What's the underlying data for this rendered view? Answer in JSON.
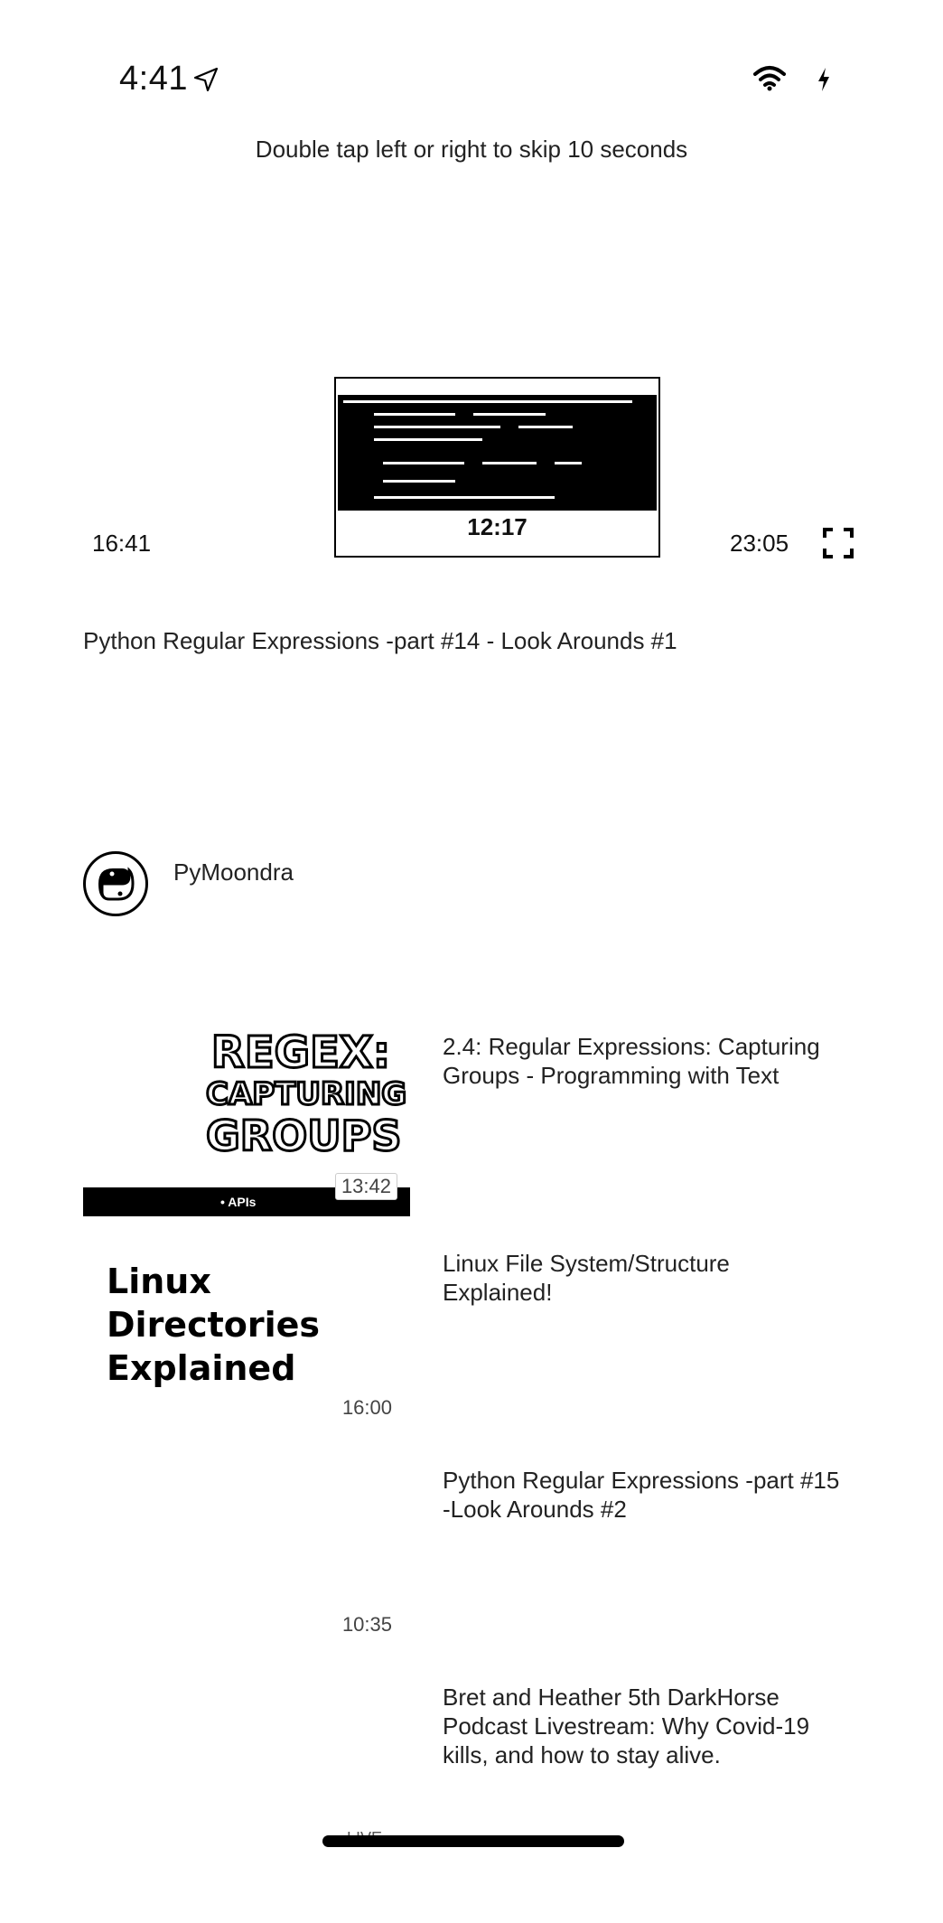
{
  "status_bar": {
    "time": "4:41",
    "icons": [
      "location-arrow-icon",
      "wifi-icon",
      "charging-bolt-icon"
    ]
  },
  "player": {
    "hint": "Double tap left or right to skip 10 seconds",
    "scrub_time": "12:17",
    "elapsed": "16:41",
    "duration": "23:05",
    "fullscreen_icon": "fullscreen-icon"
  },
  "video": {
    "title": "Python Regular Expressions -part #14 -  Look Arounds #1",
    "channel": "PyMoondra"
  },
  "recommendations": [
    {
      "thumb_text": [
        "REGEX:",
        "CAPTURING",
        "GROUPS"
      ],
      "thumb_caption": "• APIs",
      "duration": "13:42",
      "title": "2.4: Regular Expressions: Capturing Groups - Programming with Text"
    },
    {
      "thumb_text": [
        "Linux",
        "Directories",
        "Explained"
      ],
      "duration": "16:00",
      "title": "Linux File System/Structure Explained!"
    },
    {
      "duration": "10:35",
      "title": "Python Regular Expressions -part #15 -Look Arounds #2"
    },
    {
      "duration": "LIVE",
      "title": "Bret and Heather 5th DarkHorse Podcast Livestream: Why Covid-19 kills, and how to stay alive."
    }
  ]
}
